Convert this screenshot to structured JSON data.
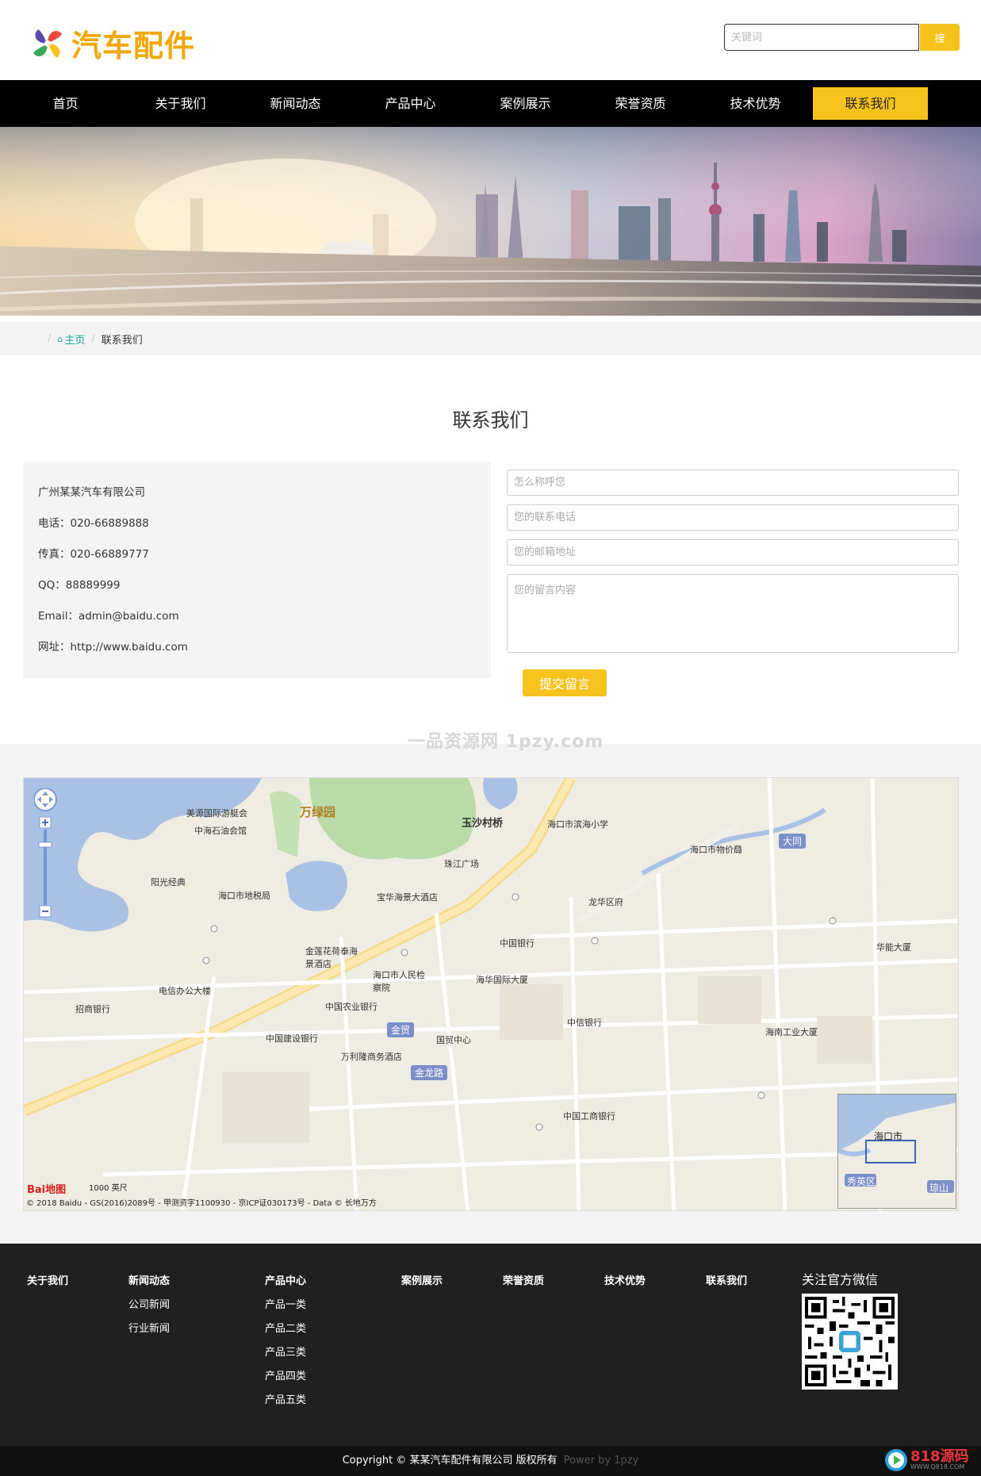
{
  "header": {
    "logo_text": "汽车配件",
    "search_placeholder": "关键词",
    "search_button": "搜"
  },
  "nav": {
    "items": [
      "首页",
      "关于我们",
      "新闻动态",
      "产品中心",
      "案例展示",
      "荣誉资质",
      "技术优势",
      "联系我们"
    ],
    "active_index": 7
  },
  "breadcrumb": {
    "home": "主页",
    "current": "联系我们"
  },
  "contact": {
    "title": "联系我们",
    "company": "广州某某汽车有限公司",
    "phone": "电话：020-66889888",
    "fax": "传真：020-66889777",
    "qq": "QQ：88889999",
    "email": "Email：admin@baidu.com",
    "website": "网址：http://www.baidu.com"
  },
  "form": {
    "name_placeholder": "怎么称呼您",
    "phone_placeholder": "您的联系电话",
    "email_placeholder": "您的邮箱地址",
    "message_placeholder": "您的留言内容",
    "submit_label": "提交留言"
  },
  "watermark": "一品资源网 1pzy.com",
  "map": {
    "labels": {
      "wanlvyuan": "万绿园",
      "yushacunqiao": "玉沙村桥",
      "jinmao": "金贸",
      "jinlonglu": "金龙路",
      "datong": "大同",
      "haikou_city": "海口市",
      "xiuying": "秀英区",
      "qiongshan": "琼山",
      "meiyuan": "美源国际游艇会",
      "zhonghai": "中海石油会馆",
      "haikou_taxi": "海口市地税局",
      "zhujiang": "珠江广场",
      "baohua": "宝华海景大酒店",
      "zhongguo_nongye": "中国农业银行",
      "zhongguo_jianshe": "中国建设银行",
      "zhongguo_yinhang": "中国银行",
      "longhua": "龙华区府",
      "guomao": "国贸中心",
      "wanli": "万利隆商务酒店",
      "zhongxin": "中信银行",
      "huaneng": "华能大厦",
      "haikou_wujia": "海口市物价局",
      "shiyanxiaoxue": "海口市滨海小学",
      "zhongguo_gongshang": "中国工商银行",
      "huanan": "海南工业大厦",
      "yangguang": "阳光经典",
      "zhaoshang": "招商银行",
      "dianxin": "电信办公大楼",
      "jinlian": "金莲花荷泰海景酒店",
      "haikou_renmin": "海口市人民检察院",
      "haihua": "海华国际大厦"
    },
    "copyright": "© 2018 Baidu - GS(2016)2089号 - 甲测资字1100930 - 京ICP证030173号 - Data © 长地万方",
    "scale": "1000 英尺",
    "logo": "Bai地图"
  },
  "footer": {
    "columns": [
      {
        "title": "关于我们",
        "items": []
      },
      {
        "title": "新闻动态",
        "items": [
          "公司新闻",
          "行业新闻"
        ]
      },
      {
        "title": "产品中心",
        "items": [
          "产品一类",
          "产品二类",
          "产品三类",
          "产品四类",
          "产品五类"
        ]
      },
      {
        "title": "案例展示",
        "items": []
      },
      {
        "title": "荣誉资质",
        "items": []
      },
      {
        "title": "技术优势",
        "items": []
      },
      {
        "title": "联系我们",
        "items": []
      }
    ],
    "wechat_title": "关注官方微信",
    "copyright": "Copyright © 某某汽车配件有限公司 版权所有",
    "power": "Power by 1pzy",
    "corner_brand": "818源码",
    "corner_url": "WWW.Q818.COM"
  },
  "colors": {
    "accent": "#f6c21c",
    "nav_bg": "#000000",
    "footer_bg": "#202020",
    "breadcrumb_home": "#1aa89a"
  }
}
